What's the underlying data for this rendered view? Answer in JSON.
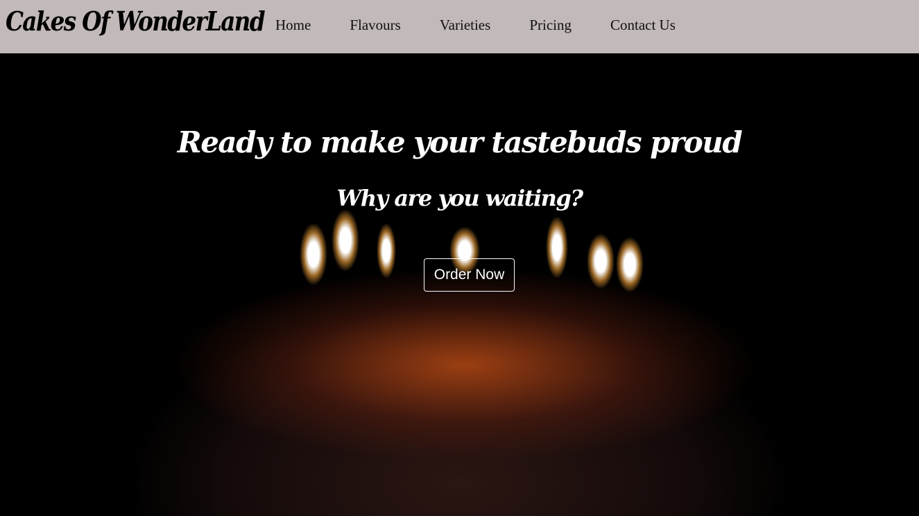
{
  "brand": "Cakes Of WonderLand",
  "nav": [
    "Home",
    "Flavours",
    "Varieties",
    "Pricing",
    "Contact Us"
  ],
  "hero": {
    "title": "Ready to make your tastebuds proud",
    "subtitle": "Why are you waiting?",
    "cta": "Order Now"
  }
}
